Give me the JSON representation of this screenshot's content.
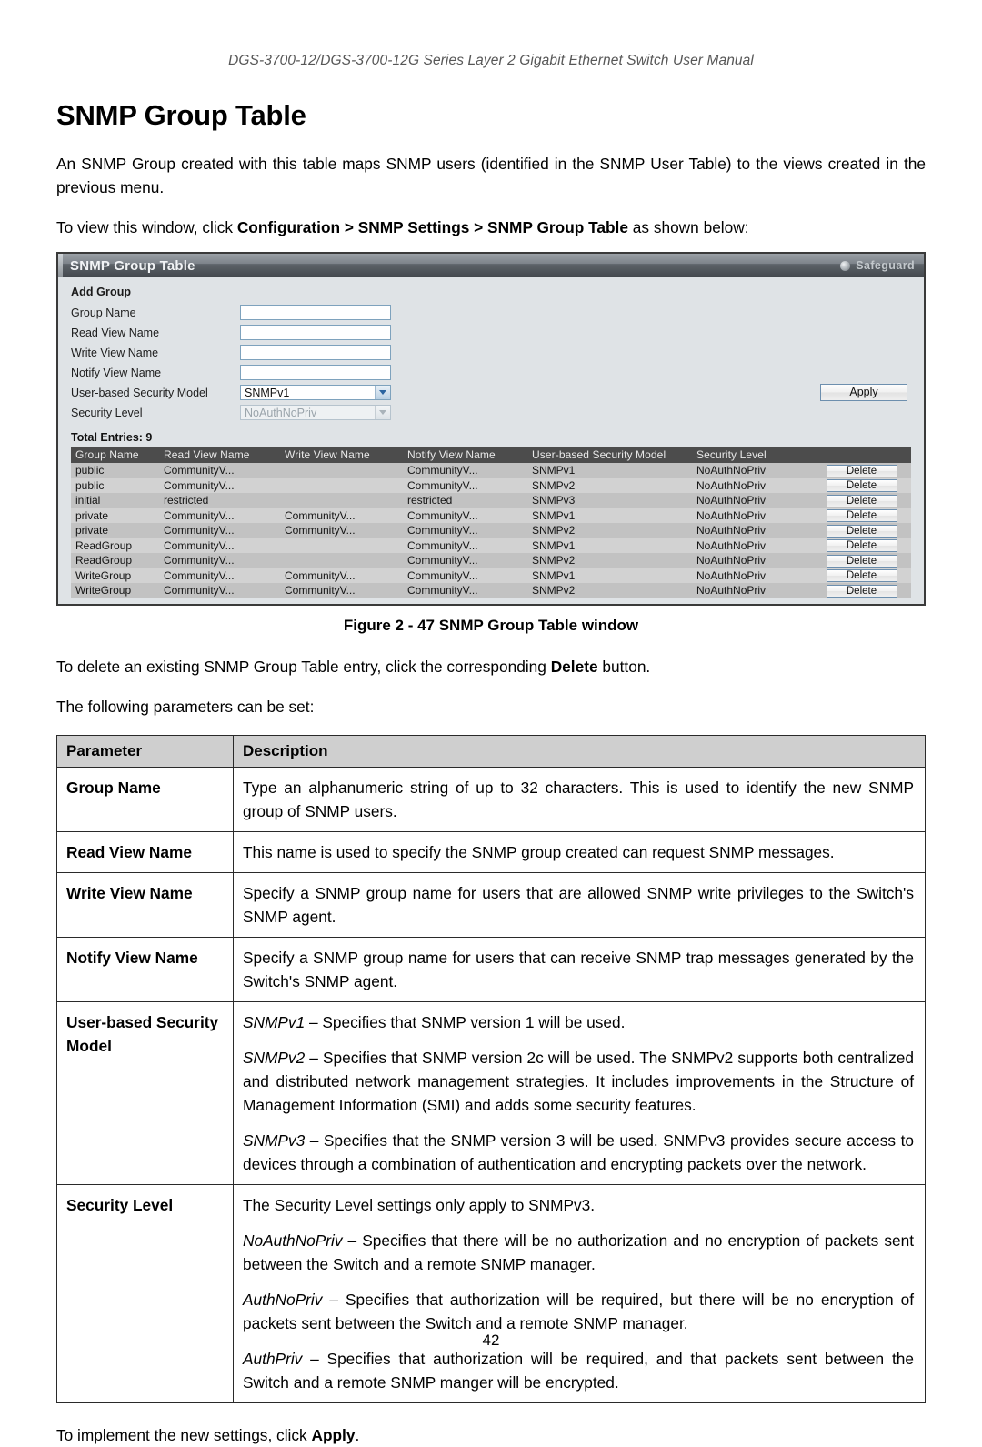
{
  "header": {
    "running_title": "DGS-3700-12/DGS-3700-12G Series Layer 2 Gigabit Ethernet Switch User Manual"
  },
  "page_title": "SNMP Group Table",
  "intro": {
    "paragraph1": "An SNMP Group created with this table maps SNMP users (identified in the SNMP User Table) to the views created in the previous menu.",
    "nav_prefix": "To view this window, click ",
    "nav_path": "Configuration > SNMP Settings > SNMP Group Table",
    "nav_suffix": " as shown below:"
  },
  "switch_ui": {
    "window_title": "SNMP Group Table",
    "safeguard_label": "Safeguard",
    "section_label": "Add Group",
    "fields": [
      {
        "label": "Group Name",
        "value": "",
        "type": "text"
      },
      {
        "label": "Read View Name",
        "value": "",
        "type": "text"
      },
      {
        "label": "Write View Name",
        "value": "",
        "type": "text"
      },
      {
        "label": "Notify View Name",
        "value": "",
        "type": "text"
      },
      {
        "label": "User-based Security Model",
        "value": "SNMPv1",
        "type": "select"
      },
      {
        "label": "Security Level",
        "value": "NoAuthNoPriv",
        "type": "select-disabled"
      }
    ],
    "apply_label": "Apply",
    "total_entries_label": "Total Entries: 9",
    "grid_headers": [
      "Group Name",
      "Read View Name",
      "Write View Name",
      "Notify View Name",
      "User-based Security Model",
      "Security Level",
      ""
    ],
    "delete_label": "Delete",
    "grid_rows": [
      {
        "group": "public",
        "read": "CommunityV...",
        "write": "",
        "notify": "CommunityV...",
        "model": "SNMPv1",
        "level": "NoAuthNoPriv"
      },
      {
        "group": "public",
        "read": "CommunityV...",
        "write": "",
        "notify": "CommunityV...",
        "model": "SNMPv2",
        "level": "NoAuthNoPriv"
      },
      {
        "group": "initial",
        "read": "restricted",
        "write": "",
        "notify": "restricted",
        "model": "SNMPv3",
        "level": "NoAuthNoPriv"
      },
      {
        "group": "private",
        "read": "CommunityV...",
        "write": "CommunityV...",
        "notify": "CommunityV...",
        "model": "SNMPv1",
        "level": "NoAuthNoPriv"
      },
      {
        "group": "private",
        "read": "CommunityV...",
        "write": "CommunityV...",
        "notify": "CommunityV...",
        "model": "SNMPv2",
        "level": "NoAuthNoPriv"
      },
      {
        "group": "ReadGroup",
        "read": "CommunityV...",
        "write": "",
        "notify": "CommunityV...",
        "model": "SNMPv1",
        "level": "NoAuthNoPriv"
      },
      {
        "group": "ReadGroup",
        "read": "CommunityV...",
        "write": "",
        "notify": "CommunityV...",
        "model": "SNMPv2",
        "level": "NoAuthNoPriv"
      },
      {
        "group": "WriteGroup",
        "read": "CommunityV...",
        "write": "CommunityV...",
        "notify": "CommunityV...",
        "model": "SNMPv1",
        "level": "NoAuthNoPriv"
      },
      {
        "group": "WriteGroup",
        "read": "CommunityV...",
        "write": "CommunityV...",
        "notify": "CommunityV...",
        "model": "SNMPv2",
        "level": "NoAuthNoPriv"
      }
    ]
  },
  "figure_caption": "Figure 2 - 47 SNMP Group Table window",
  "after_figure": {
    "delete_prefix": "To delete an existing SNMP Group Table entry, click the corresponding ",
    "delete_bold": "Delete",
    "delete_suffix": " button.",
    "params_intro": "The following parameters can be set:"
  },
  "param_table": {
    "header_parameter": "Parameter",
    "header_description": "Description",
    "rows": [
      {
        "name": "Group Name",
        "paragraphs": [
          {
            "text": "Type an alphanumeric string of up to 32 characters. This is used to identify the new SNMP group of SNMP users."
          }
        ]
      },
      {
        "name": "Read View Name",
        "paragraphs": [
          {
            "text": "This name is used to specify the SNMP group created can request SNMP messages."
          }
        ]
      },
      {
        "name": "Write View Name",
        "paragraphs": [
          {
            "text": "Specify a SNMP group name for users that are allowed SNMP write privileges to the Switch's SNMP agent."
          }
        ]
      },
      {
        "name": "Notify View Name",
        "paragraphs": [
          {
            "text": "Specify a SNMP group name for users that can receive SNMP trap messages generated by the Switch's SNMP agent."
          }
        ]
      },
      {
        "name": "User-based Security Model",
        "paragraphs": [
          {
            "term": "SNMPv1",
            "text": " – Specifies that SNMP version 1 will be used."
          },
          {
            "term": "SNMPv2",
            "text": " – Specifies that SNMP version 2c will be used. The SNMPv2 supports both centralized and distributed network management strategies. It includes improvements in the Structure of Management Information (SMI) and adds some security features."
          },
          {
            "term": "SNMPv3",
            "text": " – Specifies that the SNMP version 3 will be used. SNMPv3 provides secure access to devices through a combination of authentication and encrypting packets over the network."
          }
        ]
      },
      {
        "name": "Security Level",
        "paragraphs": [
          {
            "text": "The Security Level settings only apply to SNMPv3."
          },
          {
            "term": "NoAuthNoPriv",
            "text": " – Specifies that there will be no authorization and no encryption of packets sent between the Switch and a remote SNMP manager."
          },
          {
            "term": "AuthNoPriv",
            "text": " – Specifies that authorization will be required, but there will be no encryption of packets sent between the Switch and a remote SNMP manager."
          },
          {
            "term": "AuthPriv",
            "text": " – Specifies that authorization will be required, and that packets sent between the Switch and a remote SNMP manger will be encrypted."
          }
        ]
      }
    ]
  },
  "closing": {
    "prefix": "To implement the new settings, click ",
    "bold": "Apply",
    "suffix": "."
  },
  "page_number": "42"
}
